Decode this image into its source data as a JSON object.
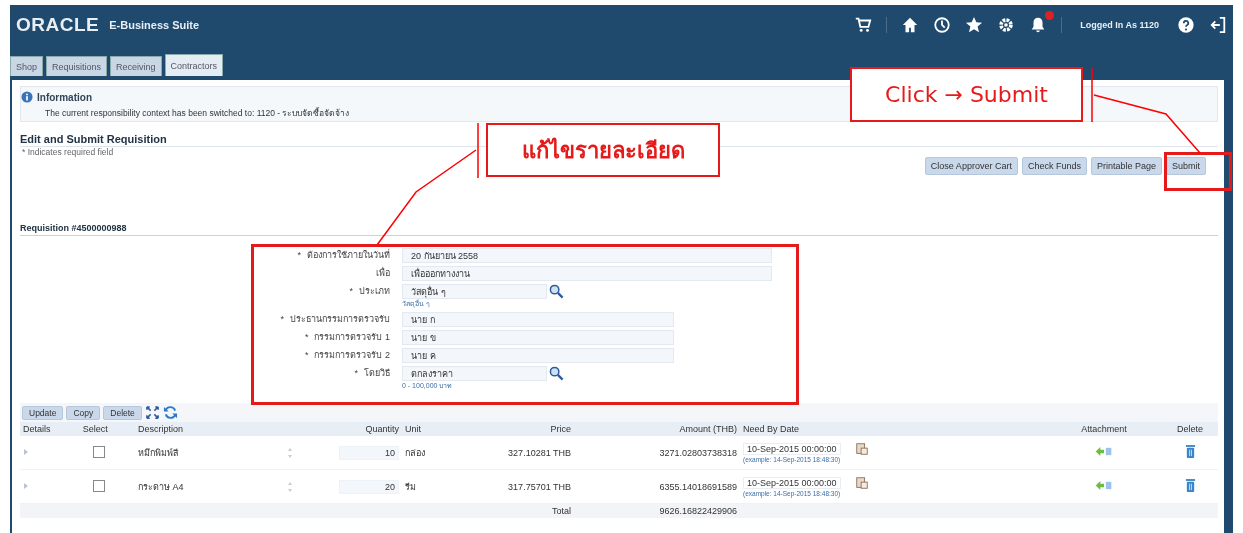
{
  "header": {
    "logo": "ORACLE",
    "product": "E-Business Suite",
    "user": "Logged In As 1120"
  },
  "tabs": [
    {
      "label": "Shop",
      "selected": false
    },
    {
      "label": "Requisitions",
      "selected": false
    },
    {
      "label": "Receiving",
      "selected": false
    },
    {
      "label": "Contractors",
      "selected": true
    }
  ],
  "info": {
    "title": "Information",
    "message": "The current responsibility context has been switched to: 1120 - ระบบจัดซื้อจัดจ้าง"
  },
  "page": {
    "title": "Edit and Submit Requisition",
    "required_note": "* Indicates required field"
  },
  "actions": [
    "Close Approver Cart",
    "Check Funds",
    "Printable Page",
    "Submit"
  ],
  "requisition": {
    "heading": "Requisition #4500000988"
  },
  "form": [
    {
      "label": "ต้องการใช้ภายในวันที่",
      "mark": "*",
      "value": "20 กันยายน 2558",
      "kind": "wide"
    },
    {
      "label": "เพื่อ",
      "value": "เพื่อออกทางงาน",
      "kind": "wide"
    },
    {
      "label": "ประเภท",
      "mark": "*",
      "value": "วัสดุอื่น ๆ",
      "kind": "lookup",
      "hint": "วัสดุอื่น ๆ"
    },
    {
      "label": "ประธานกรรมการตรวจรับ",
      "mark": "*",
      "value": "นาย ก",
      "kind": "text"
    },
    {
      "label": "กรรมการตรวจรับ 1",
      "mark": "*",
      "value": "นาย ข",
      "kind": "text"
    },
    {
      "label": "กรรมการตรวจรับ 2",
      "mark": "*",
      "value": "นาย ค",
      "kind": "text"
    },
    {
      "label": "โดยวิธี",
      "mark": "*",
      "value": "ตกลงราคา",
      "kind": "lookup",
      "hint": "0 - 100,000 บาท"
    }
  ],
  "toolbar": [
    "Update",
    "Copy",
    "Delete"
  ],
  "table": {
    "columns": [
      "Details",
      "Select",
      "Description",
      "Quantity",
      "Unit",
      "Price",
      "Amount (THB)",
      "Need By Date",
      "Attachment",
      "Delete"
    ],
    "rows": [
      {
        "checked": false,
        "description": "หมึกพิมพ์สี",
        "quantity": "10",
        "unit": "กล่อง",
        "price": "327.10281",
        "currency": "THB",
        "amount": "3271.02803738318",
        "need_by": "10-Sep-2015 00:00:00",
        "example": "(example: 14-Sep-2015 18:48:30)"
      },
      {
        "checked": false,
        "description": "กระดาษ A4",
        "quantity": "20",
        "unit": "รีม",
        "price": "317.75701",
        "currency": "THB",
        "amount": "6355.14018691589",
        "need_by": "10-Sep-2015 00:00:00",
        "example": "(example: 14-Sep-2015 18:48:30)"
      }
    ],
    "total_label": "Total",
    "total": "9626.16822429906"
  },
  "callouts": [
    {
      "text": "แก้ไขรายละเอียด"
    },
    {
      "text": "Click → Submit"
    }
  ]
}
